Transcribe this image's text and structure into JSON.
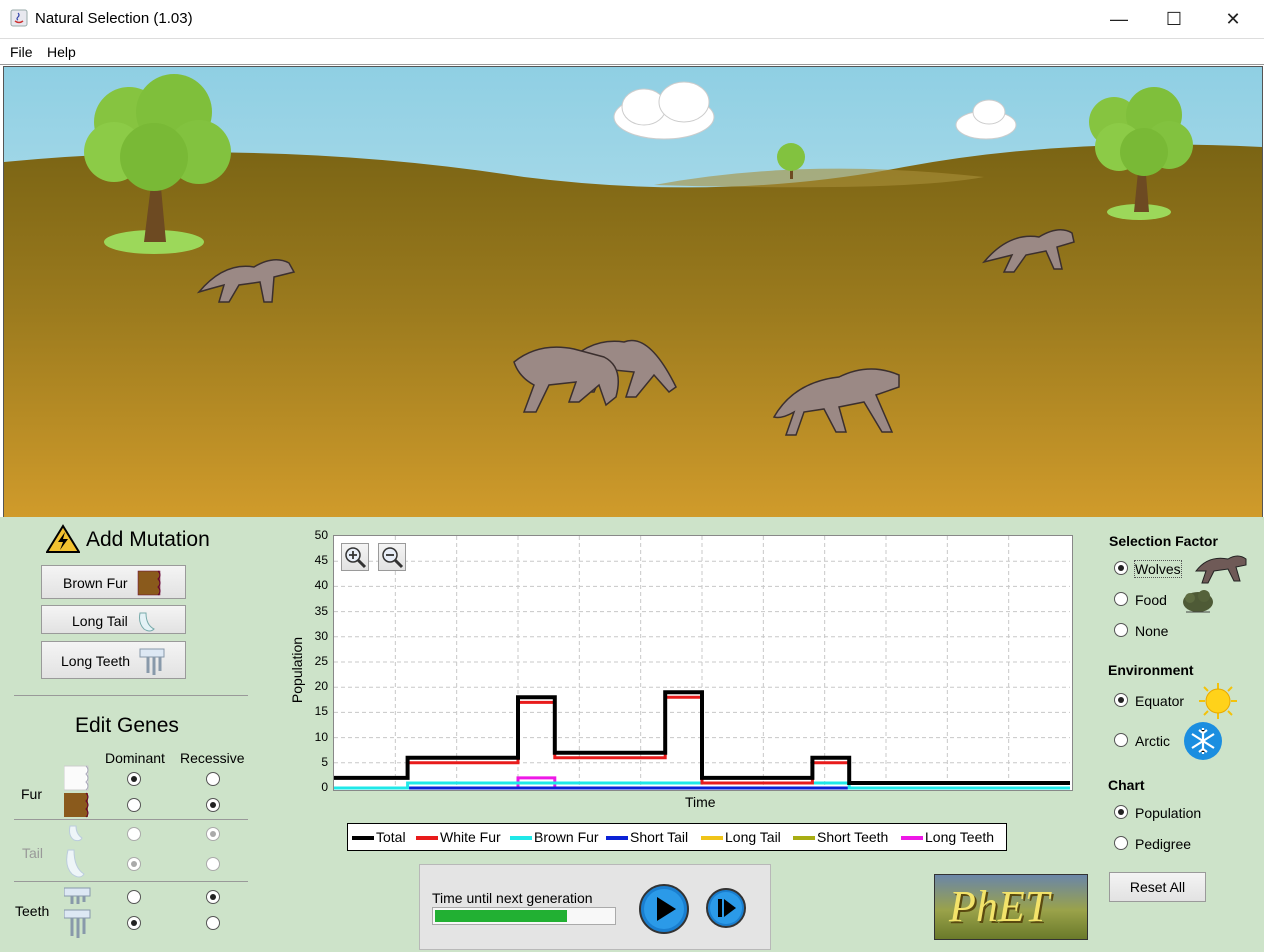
{
  "window": {
    "title": "Natural Selection (1.03)"
  },
  "menu": {
    "file": "File",
    "help": "Help"
  },
  "mutation": {
    "title": "Add Mutation",
    "buttons": [
      "Brown Fur",
      "Long Tail",
      "Long Teeth"
    ]
  },
  "genes": {
    "title": "Edit Genes",
    "dominant": "Dominant",
    "recessive": "Recessive",
    "rows": [
      "Fur",
      "Tail",
      "Teeth"
    ]
  },
  "chart_data": {
    "type": "line",
    "title": "",
    "xlabel": "Time",
    "ylabel": "Population",
    "ylim": [
      0,
      50
    ],
    "yticks": [
      "50",
      "45",
      "40",
      "35",
      "30",
      "25",
      "20",
      "15",
      "10",
      "5",
      "0"
    ],
    "series": [
      {
        "name": "Total",
        "color": "#000000",
        "values": [
          2,
          2,
          6,
          6,
          6,
          18,
          7,
          7,
          7,
          19,
          2,
          2,
          2,
          6,
          1,
          1,
          1,
          1,
          1,
          1
        ]
      },
      {
        "name": "White Fur",
        "color": "#e81b1b",
        "values": [
          2,
          2,
          5,
          5,
          5,
          17,
          6,
          6,
          6,
          18,
          1,
          1,
          1,
          5,
          1,
          1,
          1,
          1,
          1,
          1
        ]
      },
      {
        "name": "Brown Fur",
        "color": "#1fe8e8",
        "values": [
          0,
          0,
          1,
          1,
          1,
          1,
          1,
          1,
          1,
          1,
          1,
          1,
          1,
          1,
          0,
          0,
          0,
          0,
          0,
          0
        ]
      },
      {
        "name": "Short Tail",
        "color": "#0b22d6",
        "values": [
          0,
          0,
          0,
          0,
          0,
          0,
          0,
          0,
          0,
          0,
          0,
          0,
          0,
          0,
          0,
          0,
          0,
          0,
          0,
          0
        ]
      },
      {
        "name": "Long Tail",
        "color": "#f0c419",
        "values": [
          0,
          0,
          0,
          0,
          0,
          0,
          0,
          0,
          0,
          0,
          0,
          0,
          0,
          0,
          0,
          0,
          0,
          0,
          0,
          0
        ]
      },
      {
        "name": "Short Teeth",
        "color": "#a8ad13",
        "values": [
          0,
          0,
          0,
          0,
          0,
          0,
          0,
          0,
          0,
          0,
          0,
          0,
          0,
          0,
          0,
          0,
          0,
          0,
          0,
          0
        ]
      },
      {
        "name": "Long Teeth",
        "color": "#ee18e6",
        "values": [
          0,
          0,
          0,
          0,
          0,
          2,
          0,
          0,
          0,
          0,
          0,
          0,
          0,
          0,
          0,
          0,
          0,
          0,
          0,
          0
        ]
      }
    ]
  },
  "generation": {
    "label": "Time until next generation",
    "progress_percent": 74
  },
  "selection": {
    "title": "Selection Factor",
    "options": [
      "Wolves",
      "Food",
      "None"
    ],
    "selected": "Wolves"
  },
  "environment": {
    "title": "Environment",
    "options": [
      "Equator",
      "Arctic"
    ],
    "selected": "Equator"
  },
  "chart_select": {
    "title": "Chart",
    "options": [
      "Population",
      "Pedigree"
    ],
    "selected": "Population"
  },
  "reset_label": "Reset All",
  "logo_text": "PhET",
  "colors": {
    "panel": "#cde3c9",
    "sky": "#aadbe9",
    "ground": "#9a7a1c"
  }
}
